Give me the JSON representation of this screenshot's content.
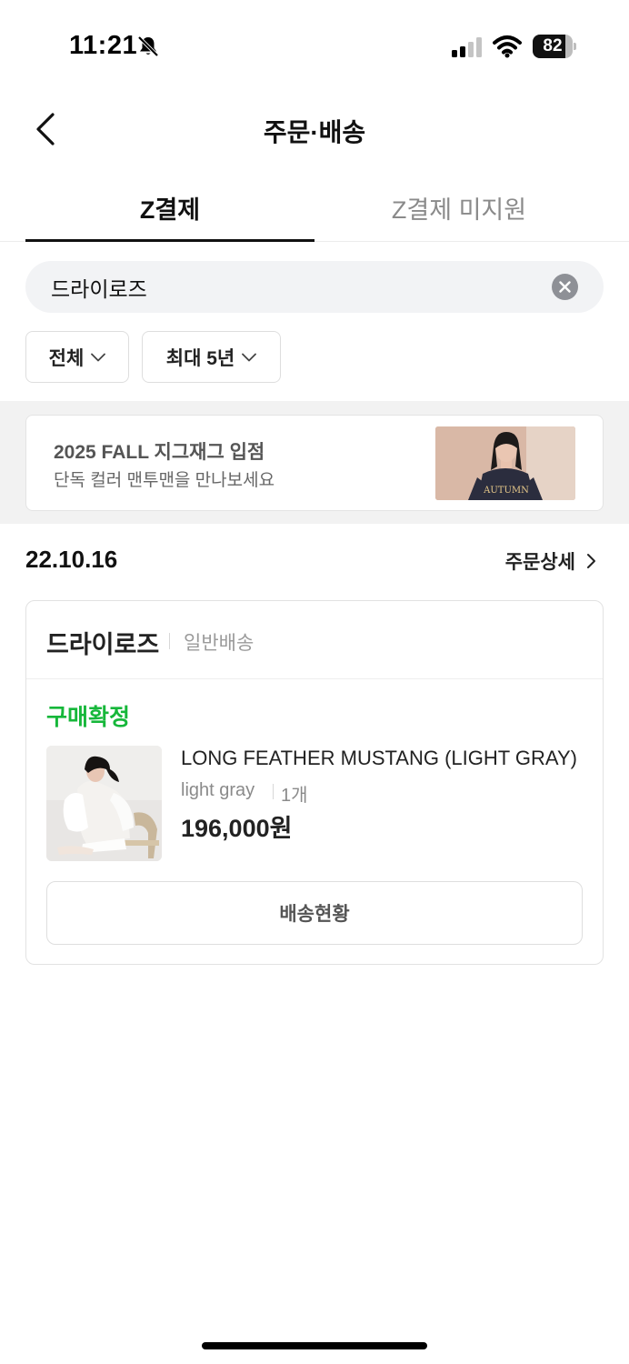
{
  "status_bar": {
    "time": "11:21",
    "battery_level": "82",
    "battery_percent": 82
  },
  "header": {
    "title": "주문·배송"
  },
  "tabs": [
    {
      "label": "Z결제",
      "active": true
    },
    {
      "label": "Z결제 미지원",
      "active": false
    }
  ],
  "search": {
    "value": "드라이로즈"
  },
  "filters": [
    {
      "label": "전체"
    },
    {
      "label": "최대 5년"
    }
  ],
  "banner": {
    "title": "2025 FALL 지그재그 입점",
    "subtitle": "단독 컬러 맨투맨을 만나보세요",
    "image_text": "AUTUMN"
  },
  "order": {
    "date": "22.10.16",
    "detail_link": "주문상세",
    "store_name": "드라이로즈",
    "shipping_type": "일반배송",
    "status": "구매확정",
    "product": {
      "name": "LONG FEATHER MUSTANG (LIGHT GRAY)",
      "option": "light gray",
      "quantity": "1개",
      "price": "196,000원"
    },
    "delivery_button": "배송현황"
  },
  "colors": {
    "accent_green": "#16b73a",
    "text_primary": "#111111",
    "tab_inactive": "#8a8a8a"
  }
}
